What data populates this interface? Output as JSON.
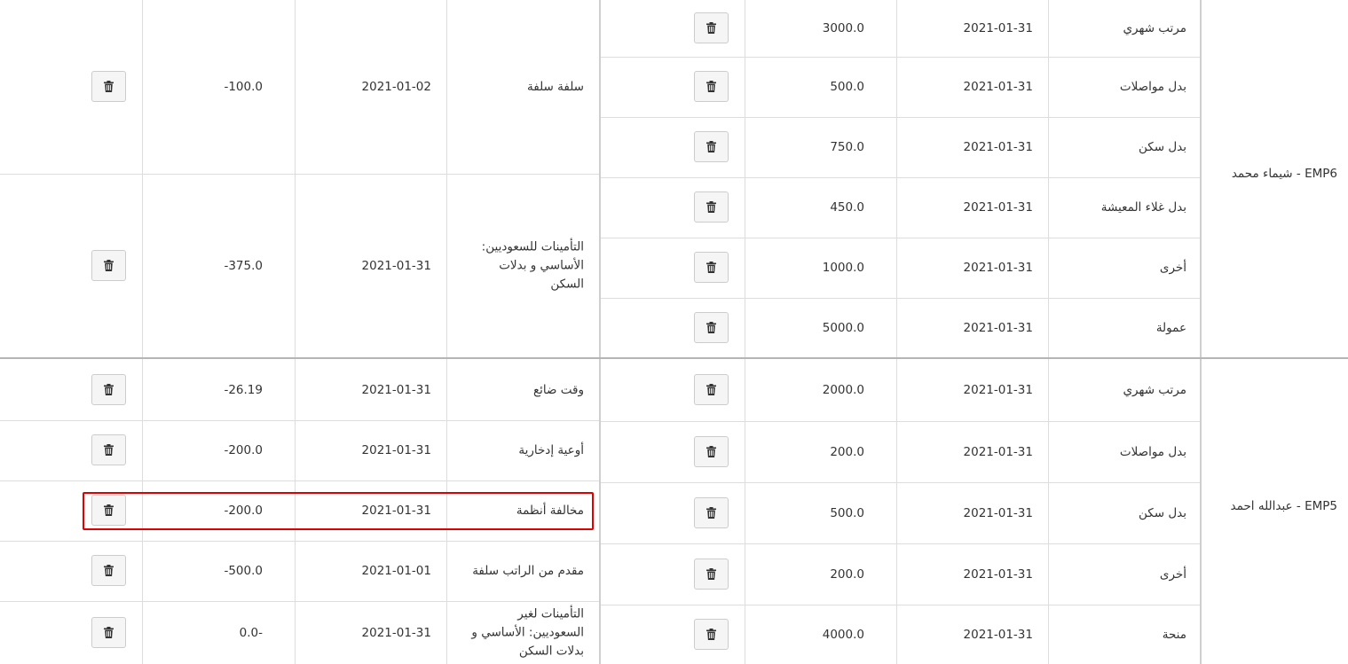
{
  "employees": [
    {
      "label": "EMP6 - شيماء محمد",
      "earnings": [
        {
          "name": "مرتب شهري",
          "date": "2021-01-31",
          "amount": "3000.0"
        },
        {
          "name": "بدل مواصلات",
          "date": "2021-01-31",
          "amount": "500.0"
        },
        {
          "name": "بدل سكن",
          "date": "2021-01-31",
          "amount": "750.0"
        },
        {
          "name": "بدل غلاء المعيشة",
          "date": "2021-01-31",
          "amount": "450.0"
        },
        {
          "name": "أخرى",
          "date": "2021-01-31",
          "amount": "1000.0"
        },
        {
          "name": "عمولة",
          "date": "2021-01-31",
          "amount": "5000.0"
        }
      ],
      "deductions": [
        {
          "name": "سلفة سلفة",
          "date": "2021-01-02",
          "amount": "-100.0"
        },
        {
          "name": "التأمينات للسعوديين: الأساسي و بدلات السكن",
          "date": "2021-01-31",
          "amount": "-375.0"
        }
      ]
    },
    {
      "label": "EMP5 - عبدالله احمد",
      "earnings": [
        {
          "name": "مرتب شهري",
          "date": "2021-01-31",
          "amount": "2000.0"
        },
        {
          "name": "بدل مواصلات",
          "date": "2021-01-31",
          "amount": "200.0"
        },
        {
          "name": "بدل سكن",
          "date": "2021-01-31",
          "amount": "500.0"
        },
        {
          "name": "أخرى",
          "date": "2021-01-31",
          "amount": "200.0"
        },
        {
          "name": "منحة",
          "date": "2021-01-31",
          "amount": "4000.0"
        }
      ],
      "deductions": [
        {
          "name": "وقت ضائع",
          "date": "2021-01-31",
          "amount": "-26.19"
        },
        {
          "name": "أوعية إدخارية",
          "date": "2021-01-31",
          "amount": "-200.0"
        },
        {
          "name": "مخالفة أنظمة",
          "date": "2021-01-31",
          "amount": "-200.0"
        },
        {
          "name": "مقدم من الراتب سلفة",
          "date": "2021-01-01",
          "amount": "-500.0"
        },
        {
          "name": "التأمينات لغير السعوديين: الأساسي و بدلات السكن",
          "date": "2021-01-31",
          "amount": "0.0-"
        }
      ]
    }
  ],
  "icons": {
    "delete": "trash-icon"
  },
  "colors": {
    "highlight": "#e00000",
    "button_bg": "#f5f5f5",
    "grid": "#dddddd"
  }
}
